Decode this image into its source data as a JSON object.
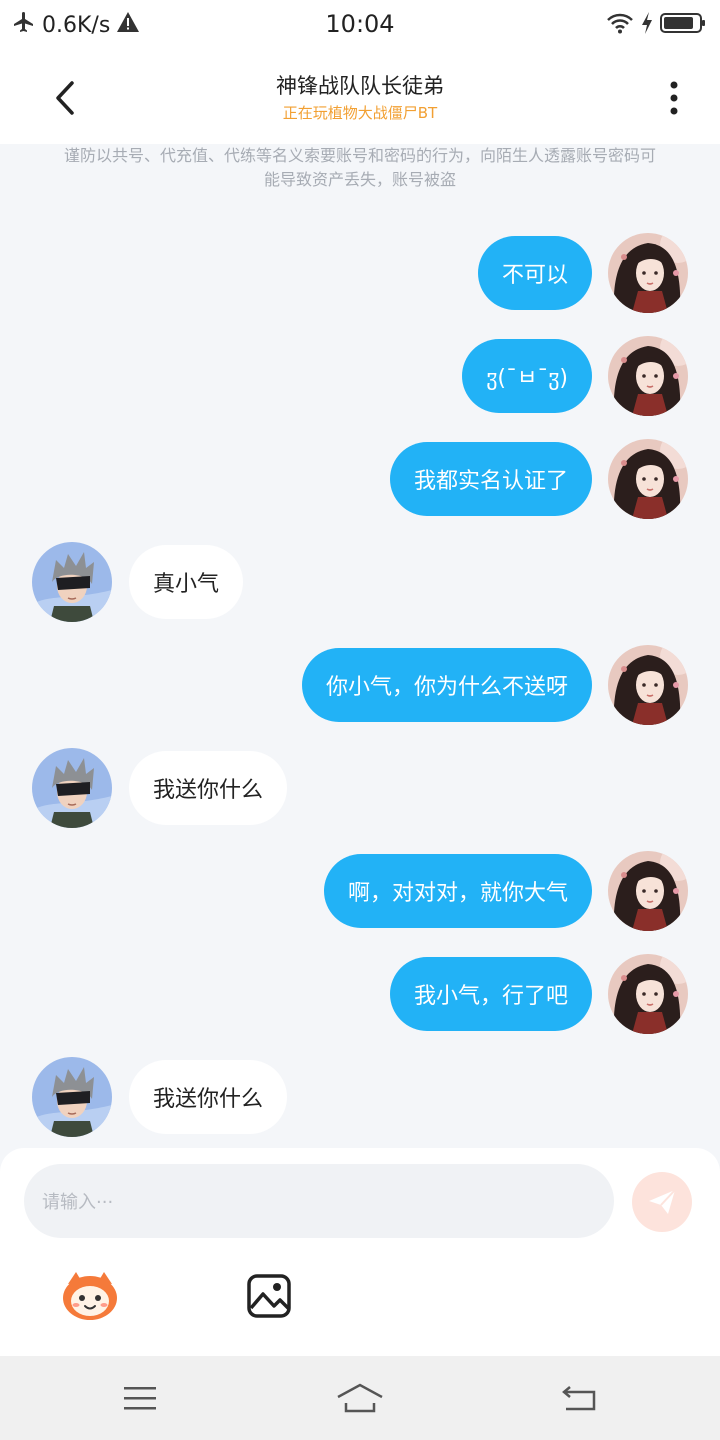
{
  "status_bar": {
    "speed": "0.6K/s",
    "time": "10:04",
    "icons": [
      "airplane-icon",
      "warning-icon",
      "wifi-icon",
      "charging-icon",
      "battery-icon"
    ]
  },
  "header": {
    "title": "神锋战队队长徒弟",
    "subtitle": "正在玩植物大战僵尸BT"
  },
  "warning_text": "谨防以共号、代充值、代练等名义索要账号和密码的行为，向陌生人透露账号密码可能导致资产丢失，账号被盗",
  "messages": [
    {
      "side": "right",
      "text": "不可以"
    },
    {
      "side": "right",
      "text": "ჳ(¯ㅂ¯ჳ)"
    },
    {
      "side": "right",
      "text": "我都实名认证了"
    },
    {
      "side": "left",
      "text": "真小气"
    },
    {
      "side": "right",
      "text": "你小气，你为什么不送呀"
    },
    {
      "side": "left",
      "text": "我送你什么"
    },
    {
      "side": "right",
      "text": "啊，对对对，就你大气"
    },
    {
      "side": "right",
      "text": "我小气，行了吧"
    },
    {
      "side": "left",
      "text": "我送你什么"
    }
  ],
  "composer": {
    "placeholder": "请输入···"
  },
  "colors": {
    "accent": "#22b2f6",
    "subtitle": "#f2a033",
    "background": "#f4f6f9"
  }
}
